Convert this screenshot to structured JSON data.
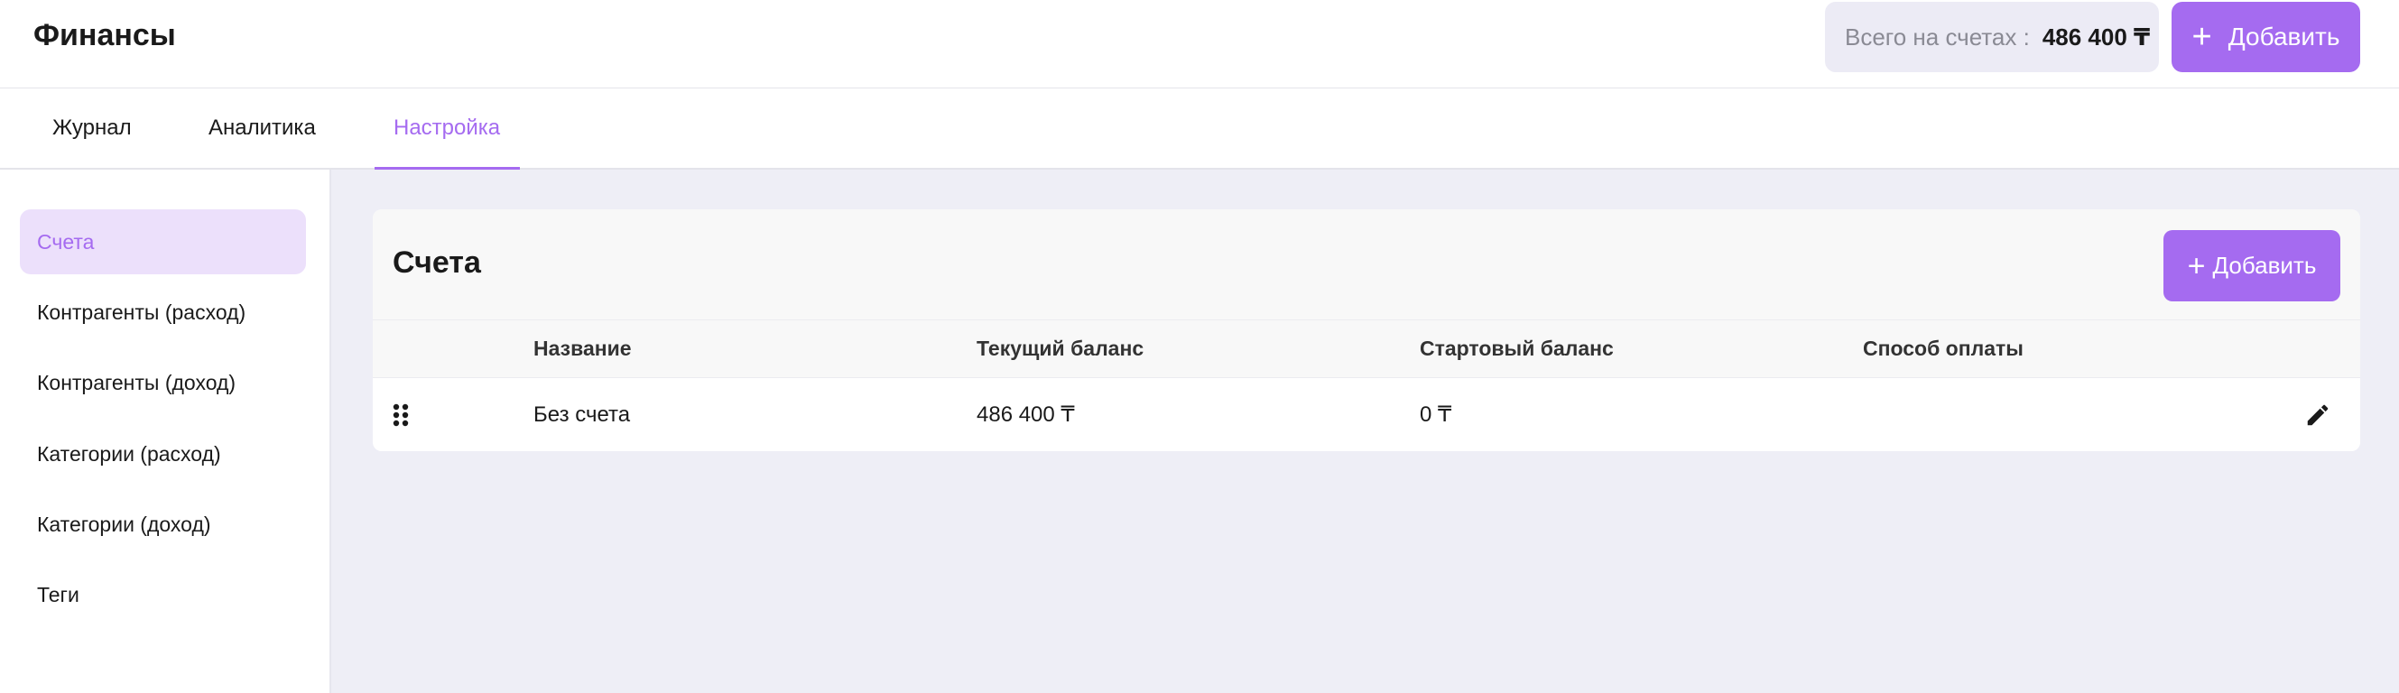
{
  "header": {
    "title": "Финансы",
    "total_label": "Всего на счетах :",
    "total_value": "486 400 ₸",
    "add_label": "Добавить"
  },
  "tabs": [
    {
      "label": "Журнал",
      "active": false
    },
    {
      "label": "Аналитика",
      "active": false
    },
    {
      "label": "Настройка",
      "active": true
    }
  ],
  "sidebar": {
    "items": [
      {
        "label": "Счета",
        "active": true
      },
      {
        "label": "Контрагенты (расход)",
        "active": false
      },
      {
        "label": "Контрагенты (доход)",
        "active": false
      },
      {
        "label": "Категории (расход)",
        "active": false
      },
      {
        "label": "Категории (доход)",
        "active": false
      },
      {
        "label": "Теги",
        "active": false
      }
    ]
  },
  "accounts": {
    "title": "Счета",
    "add_label": "Добавить",
    "columns": [
      "Название",
      "Текущий баланс",
      "Стартовый баланс",
      "Способ оплаты"
    ],
    "rows": [
      {
        "name": "Без счета",
        "current_balance": "486 400 ₸",
        "start_balance": "0 ₸",
        "payment_method": ""
      }
    ]
  },
  "colors": {
    "accent": "#a56bf0",
    "accent_light": "#ece0fb",
    "main_bg": "#eeeef6"
  },
  "icons": {
    "add": "plus-icon",
    "drag": "drag-handle-icon",
    "edit": "pencil-icon"
  }
}
